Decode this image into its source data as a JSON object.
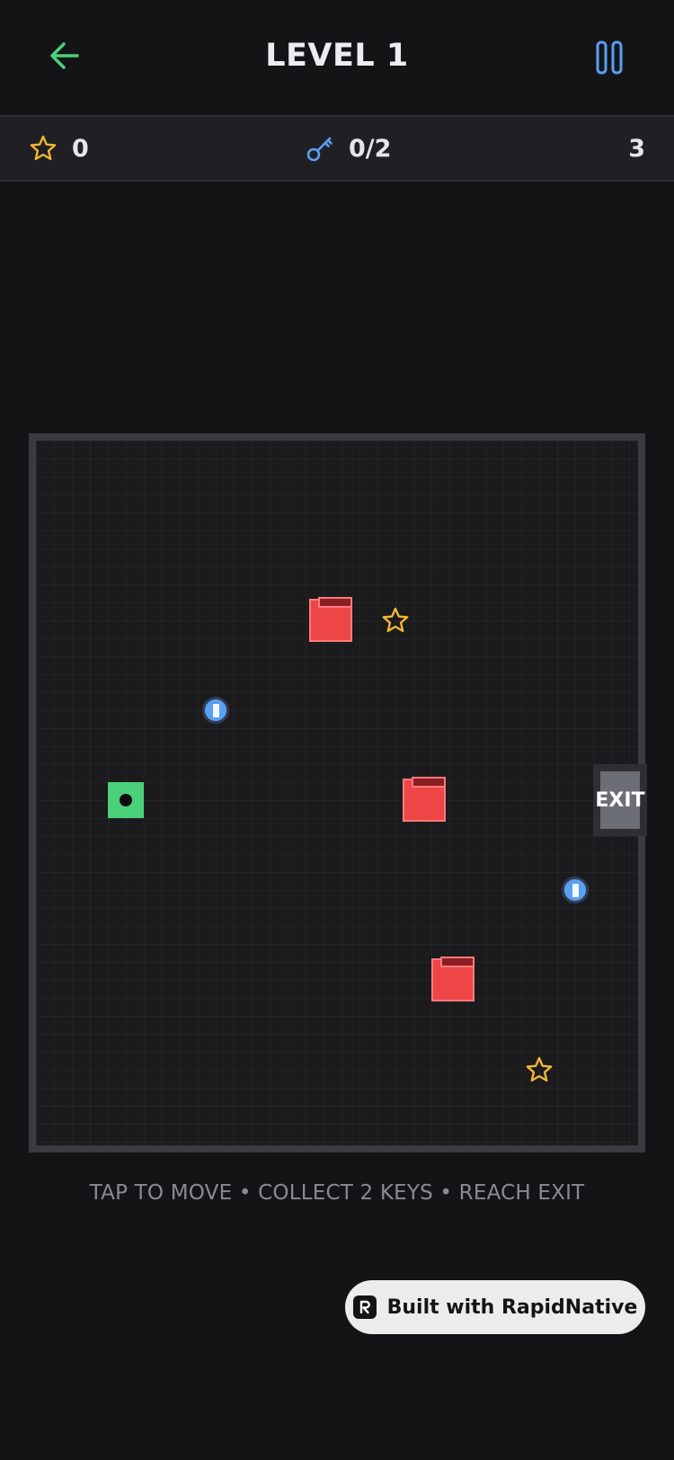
{
  "header": {
    "title": "LEVEL 1",
    "back_icon": "arrow-left-icon",
    "pause_icon": "pause-icon"
  },
  "stats": {
    "stars": "0",
    "keys": "0/2",
    "moves": "3"
  },
  "board": {
    "exit_label": "EXIT"
  },
  "hint": "TAP TO MOVE • COLLECT 2 KEYS • REACH EXIT",
  "badge": {
    "label": "Built with RapidNative"
  },
  "colors": {
    "background": "#141417",
    "accent_green": "#4ad17a",
    "accent_blue": "#5aa0f0",
    "enemy_red": "#ee4646",
    "star_gold": "#f2b632"
  }
}
